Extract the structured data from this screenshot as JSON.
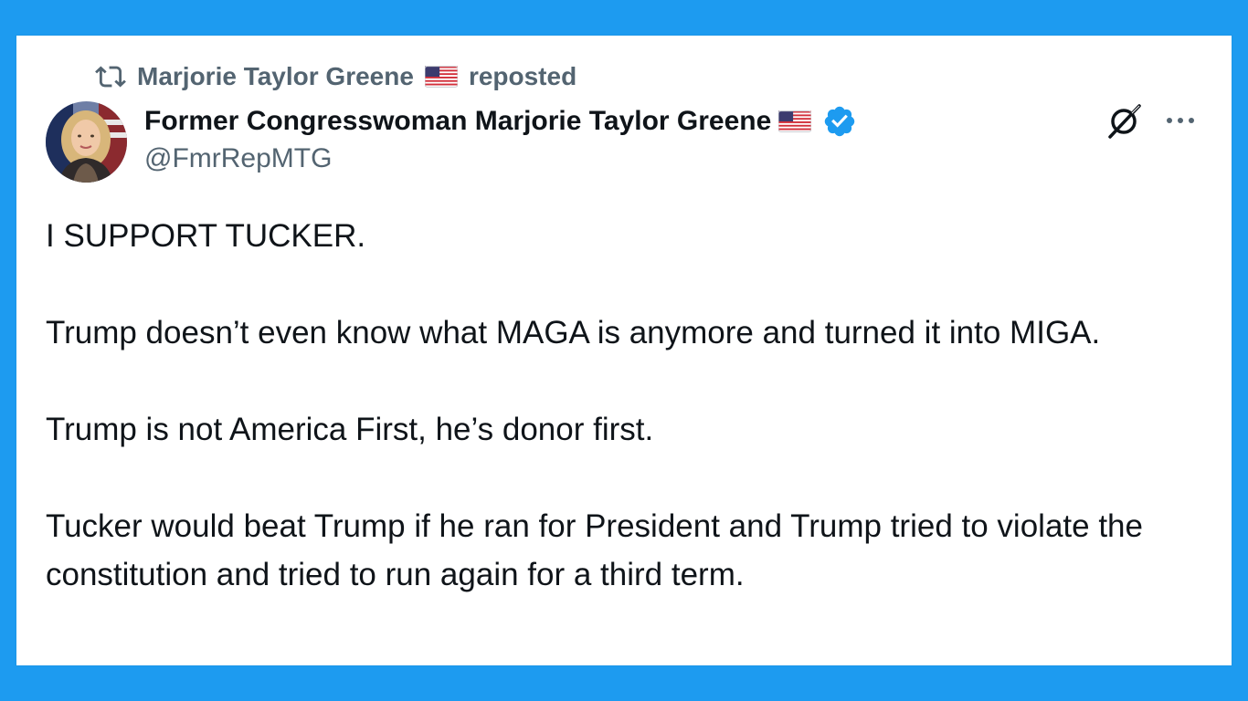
{
  "repost": {
    "reposter_name": "Marjorie Taylor Greene",
    "suffix": "reposted",
    "icon": "repost-icon",
    "flag_icon": "us-flag-icon"
  },
  "author": {
    "display_name": "Former Congresswoman Marjorie Taylor Greene",
    "flag_icon": "us-flag-icon",
    "verified_icon": "verified-badge-icon",
    "handle": "@FmrRepMTG",
    "avatar": "avatar"
  },
  "actions": {
    "grok_icon": "grok-icon",
    "more_icon": "more-icon"
  },
  "post": {
    "paragraphs": [
      "I SUPPORT TUCKER.",
      "Trump doesn’t even know what MAGA is anymore and turned it into MIGA.",
      "Trump is not America First, he’s donor first.",
      "Tucker would beat Trump if he ran for President and Trump tried to violate the constitution and tried to run again for a third term."
    ]
  },
  "colors": {
    "background": "#1d9bf0",
    "card": "#ffffff",
    "text_primary": "#0f1419",
    "text_secondary": "#536471",
    "verified_blue": "#1d9bf0"
  }
}
